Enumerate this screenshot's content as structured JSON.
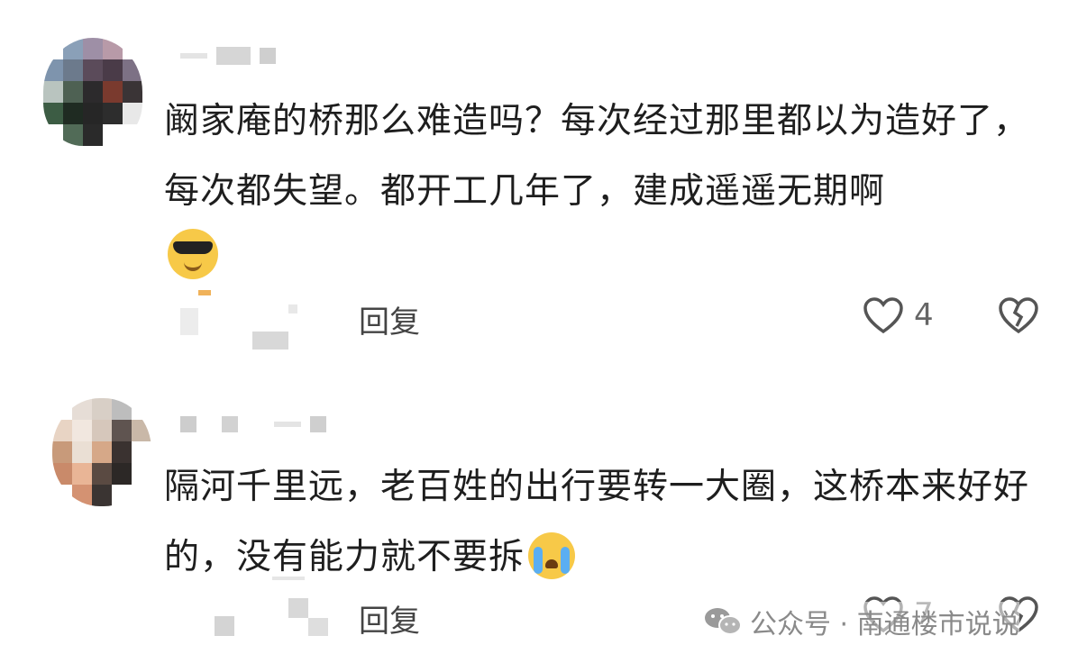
{
  "comments": [
    {
      "text": "阚家庵的桥那么难造吗？每次经过那里都以为造好了，每次都失望。都开工几年了，建成遥遥无期啊",
      "emoji": "sunglasses-emoji",
      "reply_label": "回复",
      "likes": "4"
    },
    {
      "text": "隔河千里远，老百姓的出行要转一大圈，这桥本来好好的，没有能力就不要拆",
      "emoji": "crying-emoji",
      "reply_label": "回复",
      "likes": "7"
    }
  ],
  "watermark": {
    "text": "公众号 · 南通楼市说说",
    "icon": "wechat-icon"
  },
  "colors": {
    "text": "#1e1e1e",
    "muted": "#666666",
    "emoji_yellow": "#f7c948"
  }
}
